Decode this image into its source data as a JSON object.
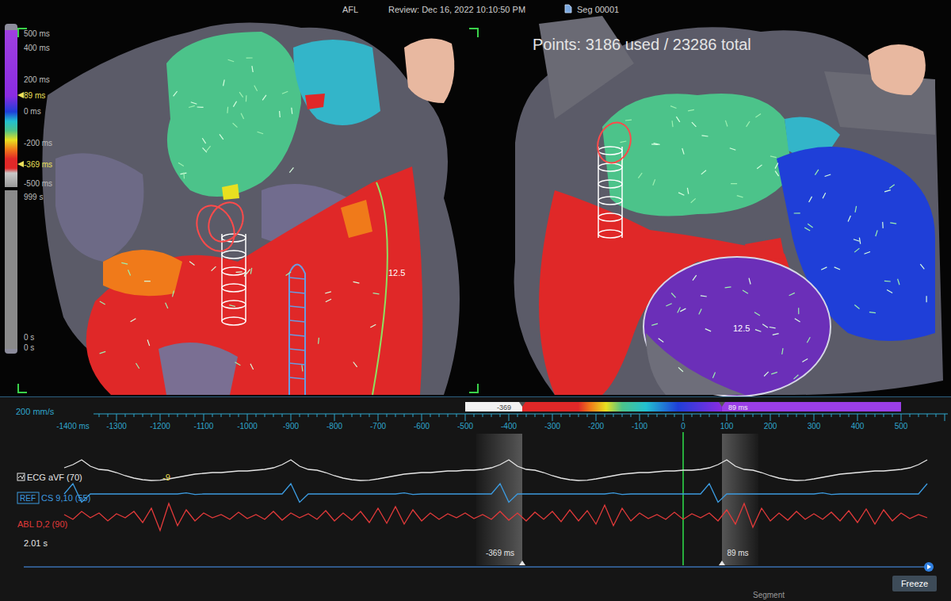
{
  "header": {
    "title": "AFL",
    "review": "Review: Dec 16, 2022 10:10:50 PM",
    "segment": "Seg 00001",
    "points": "Points: 3186 used / 23286 total"
  },
  "scale": {
    "labels": [
      {
        "text": "500 ms",
        "kind": "tick"
      },
      {
        "text": "400 ms",
        "kind": "tick"
      },
      {
        "text": "200 ms",
        "kind": "tick"
      },
      {
        "text": "89 ms",
        "kind": "marker"
      },
      {
        "text": "0 ms",
        "kind": "tick"
      },
      {
        "text": "-200 ms",
        "kind": "tick"
      },
      {
        "text": "-369 ms",
        "kind": "marker"
      },
      {
        "text": "-500 ms",
        "kind": "tick"
      }
    ],
    "time_labels": [
      "999 s",
      "0 s",
      "0 s"
    ]
  },
  "maps": [
    {
      "label": "12.5"
    },
    {
      "label": "12.5"
    }
  ],
  "timeline": {
    "speed": "200 mm/s",
    "ticks": [
      "-1400 ms",
      "-1300",
      "-1200",
      "-1100",
      "-1000",
      "-900",
      "-800",
      "-700",
      "-600",
      "-500",
      "-400",
      "-300",
      "-200",
      "-100",
      "0",
      "100",
      "200",
      "300",
      "400",
      "500"
    ],
    "colorbar_markers": [
      {
        "label": "-369"
      },
      {
        "label": "89 ms"
      }
    ],
    "windows": [
      {
        "label": "-369 ms"
      },
      {
        "label": "89 ms"
      }
    ],
    "duration": "2.01 s"
  },
  "traces": [
    {
      "name": "ECG aVF (70)",
      "reading": "-9",
      "color": "#e6e6e6",
      "values": [
        0.4,
        0.6,
        0.9,
        0.5,
        0.3,
        0.25,
        0.1,
        -0.1,
        -0.25,
        -0.35,
        -0.4,
        -0.38,
        -0.3,
        -0.2,
        -0.1,
        0,
        0.05,
        0.1,
        0.1,
        0.15,
        0.2,
        0.2,
        0.25,
        0.3,
        0.4,
        0.6,
        0.9,
        0.5,
        0.3,
        0.25,
        0.1,
        -0.1,
        -0.25,
        -0.35,
        -0.4,
        -0.38,
        -0.3,
        -0.2,
        -0.1,
        0,
        0.05,
        0.1,
        0.1,
        0.15,
        0.2,
        0.2,
        0.25,
        0.25,
        0.3,
        0.4,
        0.6,
        0.9,
        0.5,
        0.3,
        0.25,
        0.1,
        -0.1,
        -0.25,
        -0.35,
        -0.4,
        -0.38,
        -0.3,
        -0.2,
        -0.1,
        0,
        0.05,
        0.1,
        0.1,
        0.15,
        0.2,
        0.2,
        0.25,
        0.25,
        0.3,
        0.4,
        0.6,
        0.9,
        0.5,
        0.3,
        0.25,
        0.1,
        -0.1,
        -0.25,
        -0.35,
        -0.4,
        -0.38,
        -0.3,
        -0.2,
        -0.1,
        0,
        0.05,
        0.1,
        0.15,
        0.2,
        0.2,
        0.25,
        0.3,
        0.4,
        0.6,
        0.9
      ]
    },
    {
      "badge": "REF",
      "name": "CS 9,10 (55)",
      "color": "#3c9be0",
      "values": [
        0,
        1,
        -0.8,
        0,
        0,
        0,
        0,
        0,
        0,
        0,
        0,
        0,
        0,
        0,
        0.1,
        -0.05,
        0,
        0,
        0,
        0,
        0,
        0,
        0,
        0,
        0,
        0,
        1,
        -0.8,
        0,
        0,
        0,
        0,
        0,
        0,
        0,
        0,
        0,
        0,
        0,
        0.1,
        -0.05,
        0,
        0,
        0,
        0,
        0,
        0,
        0,
        0,
        0,
        1,
        -0.8,
        0,
        0,
        0,
        0,
        0,
        0,
        0,
        0,
        0,
        0,
        0,
        0.1,
        -0.05,
        0,
        0,
        0,
        0,
        0,
        0,
        0,
        0,
        0,
        1,
        -0.8,
        0,
        0,
        0,
        0,
        0,
        0,
        0,
        0,
        0,
        0,
        0,
        0.1,
        -0.05,
        0,
        0,
        0,
        0,
        0,
        0,
        0,
        0,
        0,
        0,
        1
      ]
    },
    {
      "name": "ABL D,2 (90)",
      "color": "#e23a3a",
      "values": [
        0.1,
        -0.2,
        0.3,
        -0.1,
        0.2,
        -0.3,
        0.15,
        -0.1,
        0.3,
        -0.4,
        0.5,
        -0.9,
        0.8,
        -0.6,
        0.4,
        -0.3,
        0.2,
        -0.1,
        0.1,
        -0.2,
        0.25,
        -0.15,
        0.1,
        -0.2,
        0.3,
        -0.25,
        0.2,
        -0.1,
        0.15,
        -0.2,
        0.35,
        -0.3,
        0.2,
        -0.25,
        0.3,
        -0.4,
        0.5,
        -0.45,
        0.6,
        -0.5,
        0.4,
        -0.3,
        0.2,
        -0.2,
        0.15,
        -0.1,
        0.2,
        -0.15,
        0.1,
        -0.2,
        0.3,
        -0.25,
        0.2,
        -0.3,
        0.25,
        -0.2,
        0.3,
        -0.35,
        0.4,
        -0.3,
        0.35,
        -0.5,
        0.7,
        -0.6,
        0.5,
        -0.3,
        0.2,
        -0.15,
        0.1,
        -0.2,
        0.25,
        -0.2,
        0.15,
        -0.1,
        0.2,
        -0.3,
        0.4,
        -0.5,
        0.8,
        -0.7,
        0.5,
        -0.3,
        0.2,
        -0.25,
        0.3,
        -0.2,
        0.15,
        -0.2,
        0.25,
        -0.3,
        0.35,
        -0.4,
        0.45,
        -0.5,
        0.4,
        -0.3,
        0.2,
        -0.15,
        0.1,
        -0.1
      ]
    }
  ],
  "controls": {
    "freeze": "Freeze",
    "status": "Segment"
  }
}
